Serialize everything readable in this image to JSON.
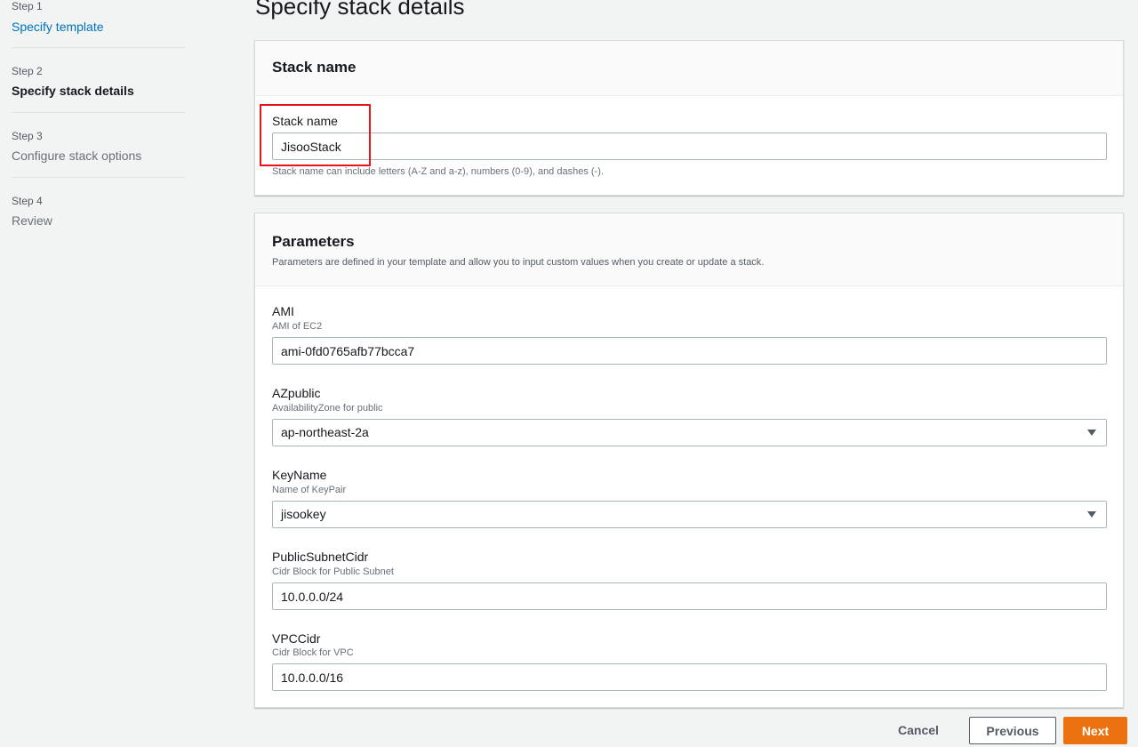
{
  "sidebar": {
    "steps": [
      {
        "num": "Step 1",
        "title": "Specify template"
      },
      {
        "num": "Step 2",
        "title": "Specify stack details"
      },
      {
        "num": "Step 3",
        "title": "Configure stack options"
      },
      {
        "num": "Step 4",
        "title": "Review"
      }
    ]
  },
  "page": {
    "title": "Specify stack details"
  },
  "stack_panel": {
    "header": "Stack name",
    "field_label": "Stack name",
    "value": "JisooStack",
    "constraint": "Stack name can include letters (A-Z and a-z), numbers (0-9), and dashes (-)."
  },
  "params_panel": {
    "header": "Parameters",
    "description": "Parameters are defined in your template and allow you to input custom values when you create or update a stack.",
    "fields": [
      {
        "label": "AMI",
        "desc": "AMI of EC2",
        "value": "ami-0fd0765afb77bcca7",
        "type": "text"
      },
      {
        "label": "AZpublic",
        "desc": "AvailabilityZone for public",
        "value": "ap-northeast-2a",
        "type": "select"
      },
      {
        "label": "KeyName",
        "desc": "Name of KeyPair",
        "value": "jisookey",
        "type": "select"
      },
      {
        "label": "PublicSubnetCidr",
        "desc": "Cidr Block for Public Subnet",
        "value": "10.0.0.0/24",
        "type": "text"
      },
      {
        "label": "VPCCidr",
        "desc": "Cidr Block for VPC",
        "value": "10.0.0.0/16",
        "type": "text"
      }
    ]
  },
  "footer": {
    "cancel": "Cancel",
    "previous": "Previous",
    "next": "Next"
  },
  "colors": {
    "accent": "#ec7211",
    "link": "#0073bb",
    "highlight": "#e8141b"
  }
}
